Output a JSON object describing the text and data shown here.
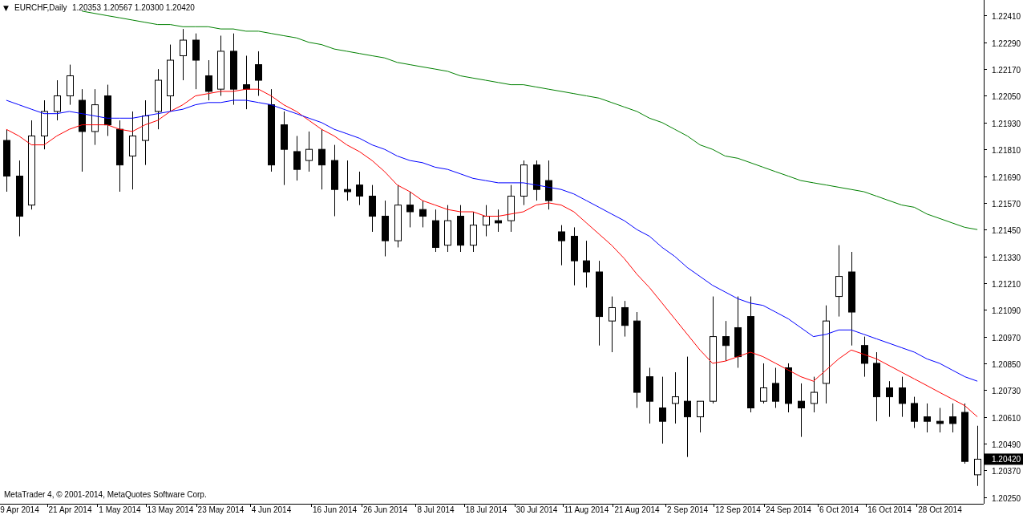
{
  "chart": {
    "menu_glyph": "▼",
    "symbol": "EURCHF,Daily",
    "quote": "1.20353 1.20567 1.20300 1.20420",
    "current_price": "1.20420",
    "footer": "MetaTrader 4, © 2001-2014, MetaQuotes Software Corp.",
    "chart_data": {
      "type": "candlestick",
      "ylim": [
        1.2022,
        1.2248
      ],
      "categories": [
        null,
        "9 Apr 2014",
        null,
        null,
        null,
        "21 Apr 2014",
        null,
        null,
        null,
        "1 May 2014",
        null,
        null,
        null,
        "13 May 2014",
        null,
        null,
        null,
        "23 May 2014",
        null,
        null,
        null,
        "4 Jun 2014",
        null,
        null,
        null,
        null,
        "16 Jun 2014",
        null,
        null,
        null,
        "26 Jun 2014",
        null,
        null,
        null,
        "8 Jul 2014",
        null,
        null,
        null,
        "18 Jul 2014",
        null,
        null,
        null,
        "30 Jul 2014",
        null,
        null,
        null,
        "11 Aug 2014",
        null,
        null,
        null,
        "21 Aug 2014",
        null,
        null,
        null,
        "2 Sep 2014",
        null,
        null,
        null,
        "12 Sep 2014",
        null,
        null,
        null,
        "24 Sep 2014",
        null,
        null,
        null,
        "6 Oct 2014",
        null,
        null,
        null,
        "16 Oct 2014",
        null,
        null,
        null,
        "28 Oct 2014",
        null,
        null,
        null
      ],
      "yticks": [
        {
          "value": 1.2241,
          "label": "1.22410"
        },
        {
          "value": 1.2229,
          "label": "1.22290"
        },
        {
          "value": 1.2217,
          "label": "1.22170"
        },
        {
          "value": 1.2205,
          "label": "1.22050"
        },
        {
          "value": 1.2193,
          "label": "1.21930"
        },
        {
          "value": 1.2181,
          "label": "1.21810"
        },
        {
          "value": 1.2169,
          "label": "1.21690"
        },
        {
          "value": 1.2157,
          "label": "1.21570"
        },
        {
          "value": 1.2145,
          "label": "1.21450"
        },
        {
          "value": 1.2133,
          "label": "1.21330"
        },
        {
          "value": 1.2121,
          "label": "1.21210"
        },
        {
          "value": 1.2109,
          "label": "1.21090"
        },
        {
          "value": 1.2097,
          "label": "1.20970"
        },
        {
          "value": 1.2085,
          "label": "1.20850"
        },
        {
          "value": 1.2073,
          "label": "1.20730"
        },
        {
          "value": 1.2061,
          "label": "1.20610"
        },
        {
          "value": 1.2049,
          "label": "1.20490"
        },
        {
          "value": 1.2037,
          "label": "1.20370"
        },
        {
          "value": 1.2025,
          "label": "1.20250"
        }
      ],
      "ohlc": [
        [
          1.2185,
          1.219,
          1.2162,
          1.2169
        ],
        [
          1.2169,
          1.2176,
          1.2142,
          1.2151
        ],
        [
          1.2156,
          1.2194,
          1.2154,
          1.2187
        ],
        [
          1.2187,
          1.2203,
          1.2181,
          1.2198
        ],
        [
          1.2198,
          1.2212,
          1.2194,
          1.2205
        ],
        [
          1.2205,
          1.2219,
          1.2201,
          1.2214
        ],
        [
          1.2203,
          1.2208,
          1.2171,
          1.2189
        ],
        [
          1.2189,
          1.2208,
          1.2183,
          1.2201
        ],
        [
          1.2205,
          1.221,
          1.2187,
          1.2192
        ],
        [
          1.219,
          1.2194,
          1.2162,
          1.2174
        ],
        [
          1.2178,
          1.2198,
          1.2163,
          1.2187
        ],
        [
          1.2185,
          1.2203,
          1.2174,
          1.2196
        ],
        [
          1.2198,
          1.2217,
          1.219,
          1.2212
        ],
        [
          1.2205,
          1.2228,
          1.2198,
          1.2221
        ],
        [
          1.2223,
          1.2235,
          1.2212,
          1.223
        ],
        [
          1.223,
          1.2233,
          1.2208,
          1.2221
        ],
        [
          1.2214,
          1.2221,
          1.2203,
          1.2207
        ],
        [
          1.2208,
          1.2232,
          1.2205,
          1.2225
        ],
        [
          1.2225,
          1.2233,
          1.2201,
          1.2208
        ],
        [
          1.221,
          1.2223,
          1.2199,
          1.2208
        ],
        [
          1.2219,
          1.2225,
          1.2205,
          1.2212
        ],
        [
          1.2201,
          1.2208,
          1.2171,
          1.2174
        ],
        [
          1.2192,
          1.2198,
          1.2165,
          1.2181
        ],
        [
          1.218,
          1.2187,
          1.2167,
          1.2172
        ],
        [
          1.2176,
          1.2189,
          1.2171,
          1.2181
        ],
        [
          1.2181,
          1.219,
          1.2163,
          1.2174
        ],
        [
          1.2176,
          1.2183,
          1.2151,
          1.2163
        ],
        [
          1.2163,
          1.2176,
          1.2158,
          1.2162
        ],
        [
          1.2165,
          1.2171,
          1.2156,
          1.216
        ],
        [
          1.216,
          1.2165,
          1.2144,
          1.2151
        ],
        [
          1.2151,
          1.2158,
          1.2133,
          1.214
        ],
        [
          1.214,
          1.2165,
          1.2137,
          1.2156
        ],
        [
          1.2156,
          1.2162,
          1.2146,
          1.2153
        ],
        [
          1.2154,
          1.2158,
          1.2146,
          1.2151
        ],
        [
          1.2149,
          1.2154,
          1.2135,
          1.2137
        ],
        [
          1.2138,
          1.2156,
          1.2135,
          1.2149
        ],
        [
          1.2151,
          1.2156,
          1.2135,
          1.2138
        ],
        [
          1.2138,
          1.2153,
          1.2135,
          1.2147
        ],
        [
          1.2147,
          1.2156,
          1.2142,
          1.2151
        ],
        [
          1.2149,
          1.2154,
          1.2144,
          1.2148
        ],
        [
          1.2149,
          1.2165,
          1.2144,
          1.216
        ],
        [
          1.216,
          1.2176,
          1.2156,
          1.2174
        ],
        [
          1.2174,
          1.2176,
          1.2158,
          1.2163
        ],
        [
          1.2167,
          1.2176,
          1.2154,
          1.2158
        ],
        [
          1.2144,
          1.2147,
          1.2129,
          1.214
        ],
        [
          1.2142,
          1.2146,
          1.212,
          1.2131
        ],
        [
          1.2131,
          1.214,
          1.2119,
          1.2126
        ],
        [
          1.2126,
          1.2131,
          1.2093,
          1.2106
        ],
        [
          1.2104,
          1.2115,
          1.209,
          1.211
        ],
        [
          1.211,
          1.2113,
          1.2097,
          1.2102
        ],
        [
          1.2104,
          1.2108,
          1.2065,
          1.2072
        ],
        [
          1.2079,
          1.2083,
          1.2058,
          1.2068
        ],
        [
          1.2065,
          1.2079,
          1.2049,
          1.2059
        ],
        [
          1.2067,
          1.2081,
          1.2058,
          1.207
        ],
        [
          1.2068,
          1.2088,
          1.2043,
          1.2061
        ],
        [
          1.2061,
          1.2068,
          1.2054,
          1.2068
        ],
        [
          1.2068,
          1.2115,
          1.2067,
          1.2097
        ],
        [
          1.2097,
          1.2104,
          1.2086,
          1.2093
        ],
        [
          1.2101,
          1.2115,
          1.2083,
          1.2088
        ],
        [
          1.2106,
          1.2115,
          1.2063,
          1.2065
        ],
        [
          1.2068,
          1.2085,
          1.2067,
          1.2074
        ],
        [
          1.2076,
          1.2083,
          1.2065,
          1.2068
        ],
        [
          1.2083,
          1.2085,
          1.2063,
          1.2067
        ],
        [
          1.2068,
          1.2076,
          1.2052,
          1.2065
        ],
        [
          1.2067,
          1.2079,
          1.2063,
          1.2072
        ],
        [
          1.2076,
          1.2111,
          1.2067,
          1.2104
        ],
        [
          1.2115,
          1.2138,
          1.2106,
          1.2124
        ],
        [
          1.2126,
          1.2135,
          1.2093,
          1.2108
        ],
        [
          1.2093,
          1.2097,
          1.2079,
          1.2085
        ],
        [
          1.2085,
          1.209,
          1.2059,
          1.207
        ],
        [
          1.2074,
          1.2077,
          1.2061,
          1.207
        ],
        [
          1.2074,
          1.2079,
          1.2061,
          1.2067
        ],
        [
          1.2067,
          1.207,
          1.2056,
          1.2059
        ],
        [
          1.2061,
          1.2067,
          1.2054,
          1.2059
        ],
        [
          1.2059,
          1.2065,
          1.2054,
          1.2058
        ],
        [
          1.2061,
          1.2067,
          1.2054,
          1.2058
        ],
        [
          1.2063,
          1.2067,
          1.204,
          1.2041
        ],
        [
          1.2035,
          1.2057,
          1.203,
          1.2042
        ]
      ],
      "series": [
        {
          "type": "line",
          "color": "#ff0000",
          "values": [
            1.219,
            1.2187,
            1.2183,
            1.2183,
            1.2187,
            1.219,
            1.2192,
            1.2192,
            1.2192,
            1.219,
            1.2189,
            1.2192,
            1.2194,
            1.2198,
            1.2201,
            1.2205,
            1.2206,
            1.2207,
            1.2207,
            1.2208,
            1.2208,
            1.2205,
            1.2201,
            1.2198,
            1.2194,
            1.219,
            1.2187,
            1.2183,
            1.218,
            1.2176,
            1.2171,
            1.2165,
            1.2162,
            1.2158,
            1.2156,
            1.2154,
            1.2153,
            1.2153,
            1.2151,
            1.2151,
            1.2152,
            1.2153,
            1.2156,
            1.2157,
            1.2156,
            1.2153,
            1.2148,
            1.2143,
            1.2138,
            1.2132,
            1.2125,
            1.2119,
            1.2112,
            1.2105,
            1.2098,
            1.2091,
            1.2085,
            1.2086,
            1.2088,
            1.209,
            1.2088,
            1.2085,
            1.2082,
            1.2079,
            1.2077,
            1.2082,
            1.2087,
            1.2091,
            1.2089,
            1.2087,
            1.2084,
            1.2081,
            1.2078,
            1.2075,
            1.2072,
            1.2069,
            1.2066,
            1.2061
          ]
        },
        {
          "type": "line",
          "color": "#0000ff",
          "values": [
            1.2203,
            1.2201,
            1.2199,
            1.2197,
            1.2197,
            1.2198,
            1.2197,
            1.2196,
            1.2195,
            1.2195,
            1.2195,
            1.2196,
            1.2197,
            1.2198,
            1.2199,
            1.2201,
            1.2202,
            1.2202,
            1.2203,
            1.2203,
            1.2202,
            1.2201,
            1.2199,
            1.2197,
            1.2195,
            1.2193,
            1.219,
            1.2188,
            1.2186,
            1.2183,
            1.2181,
            1.2178,
            1.2176,
            1.2175,
            1.2173,
            1.2172,
            1.217,
            1.2168,
            1.2167,
            1.2166,
            1.2166,
            1.2166,
            1.2165,
            1.2164,
            1.2163,
            1.2161,
            1.2158,
            1.2155,
            1.2152,
            1.2149,
            1.2145,
            1.2142,
            1.2137,
            1.2133,
            1.2128,
            1.2124,
            1.212,
            1.2117,
            1.2114,
            1.2112,
            1.2111,
            1.2108,
            1.2105,
            1.2101,
            1.2097,
            1.2098,
            1.21,
            1.21,
            1.2098,
            1.2096,
            1.2094,
            1.2092,
            1.209,
            1.2087,
            1.2085,
            1.2082,
            1.2079,
            1.2077
          ]
        },
        {
          "type": "line",
          "color": "#008000",
          "values": [
            null,
            null,
            null,
            null,
            null,
            null,
            1.2243,
            1.2242,
            1.2241,
            1.224,
            1.2239,
            1.2238,
            1.2237,
            1.2237,
            1.2236,
            1.2236,
            1.2236,
            1.2235,
            1.2235,
            1.2234,
            1.2234,
            1.2233,
            1.2232,
            1.2231,
            1.2229,
            1.2228,
            1.2226,
            1.2225,
            1.2224,
            1.2223,
            1.2222,
            1.222,
            1.2219,
            1.2218,
            1.2217,
            1.2216,
            1.2214,
            1.2213,
            1.2212,
            1.2211,
            1.221,
            1.221,
            1.2209,
            1.2208,
            1.2207,
            1.2206,
            1.2205,
            1.2204,
            1.2202,
            1.22,
            1.2198,
            1.2195,
            1.2193,
            1.219,
            1.2187,
            1.2183,
            1.2181,
            1.2178,
            1.2177,
            1.2175,
            1.2173,
            1.2171,
            1.2169,
            1.2167,
            1.2166,
            1.2165,
            1.2164,
            1.2163,
            1.2162,
            1.216,
            1.2158,
            1.2156,
            1.2155,
            1.2152,
            1.215,
            1.2148,
            1.2146,
            1.2145
          ]
        }
      ]
    }
  }
}
